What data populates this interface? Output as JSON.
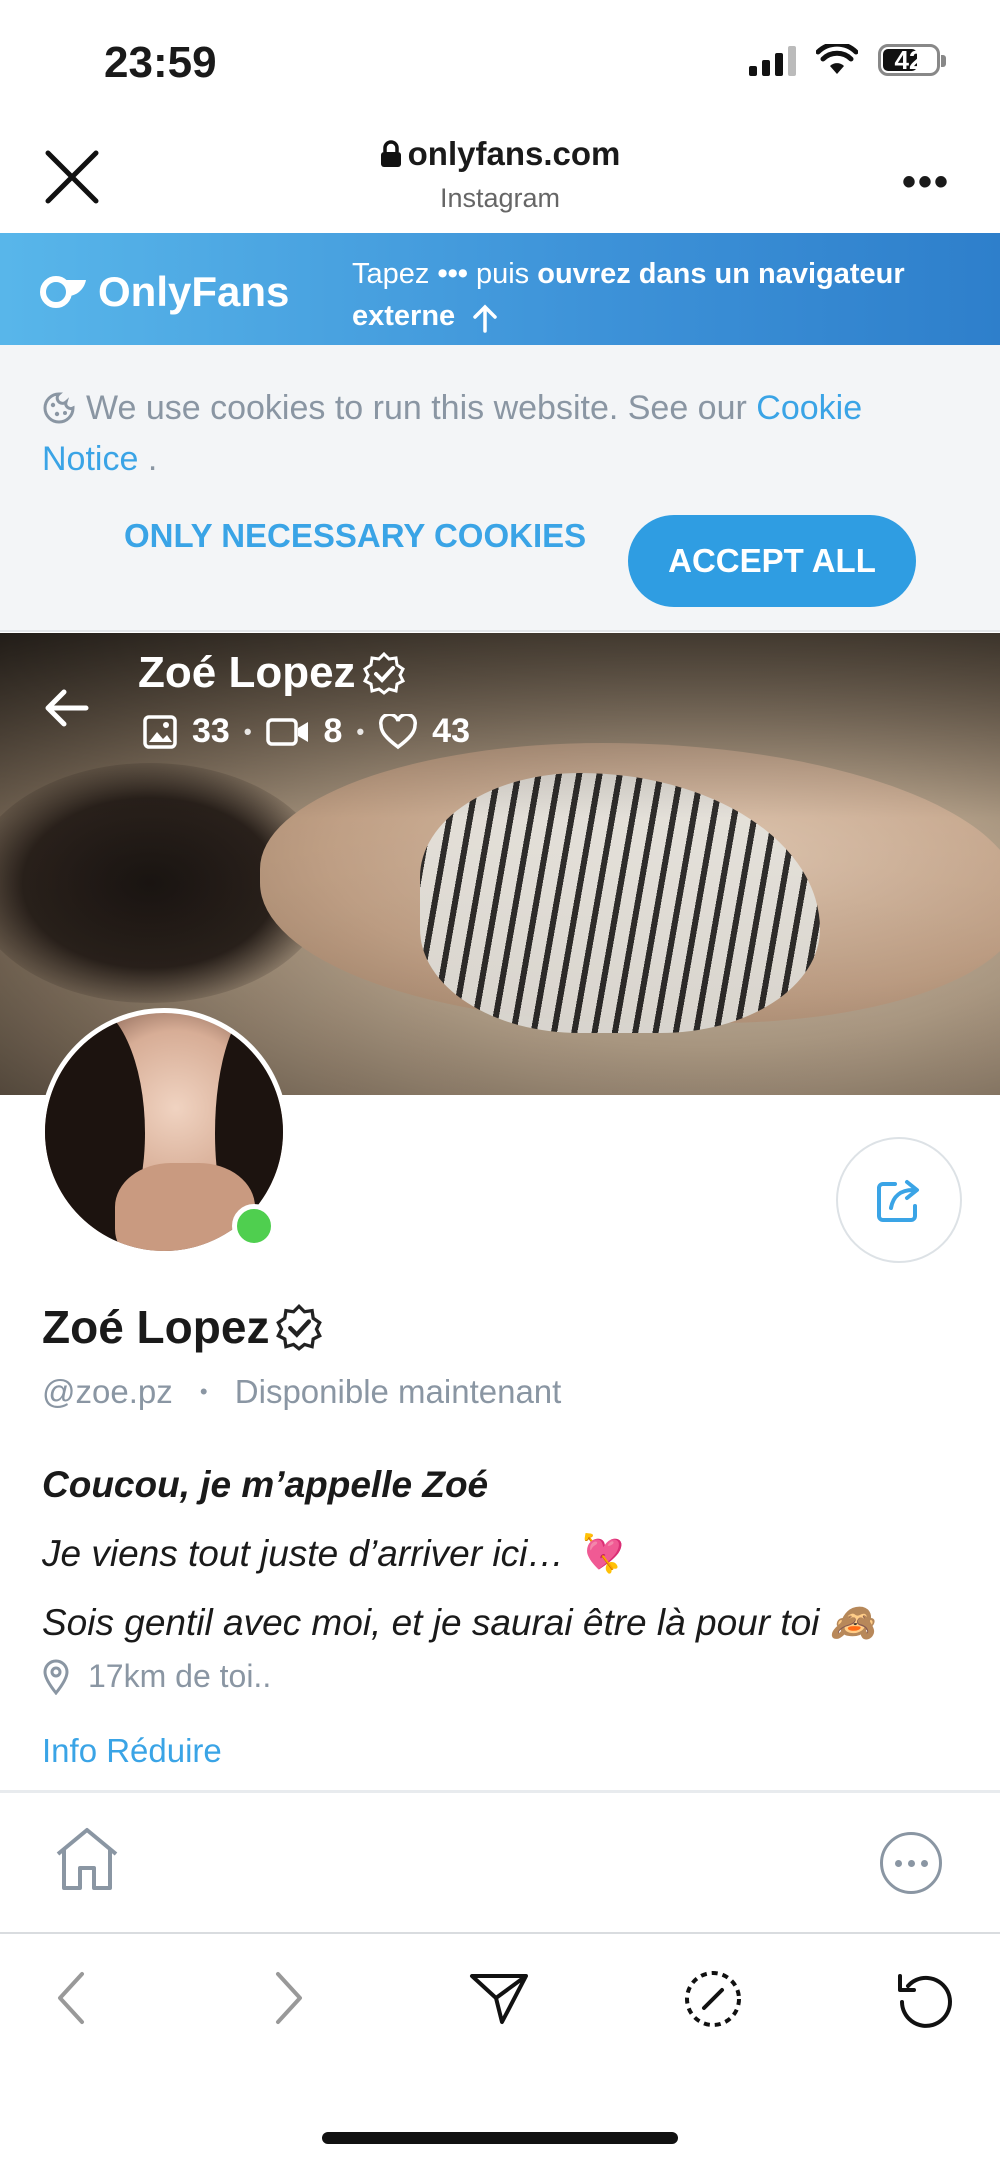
{
  "status_bar": {
    "time": "23:59",
    "battery": "42"
  },
  "browser": {
    "domain": "onlyfans.com",
    "subtitle": "Instagram",
    "more": "•••"
  },
  "banner": {
    "logo": "OnlyFans",
    "hint_part1": "Tapez",
    "hint_dots": "•••",
    "hint_part2": "puis",
    "hint_bold": "ouvrez dans un navigateur externe"
  },
  "cookies": {
    "text": "We use cookies to run this website. See our",
    "link": "Cookie Notice",
    "period": ".",
    "necessary_label": "ONLY NECESSARY COOKIES",
    "accept_label": "ACCEPT ALL"
  },
  "cover": {
    "name": "Zoé Lopez",
    "photos": "33",
    "videos": "8",
    "likes": "43"
  },
  "profile": {
    "name": "Zoé Lopez",
    "handle": "@zoe.pz",
    "separator": "•",
    "availability": "Disponible maintenant",
    "bio_line1": "Coucou, je m’appelle Zoé",
    "bio_line2": "Je viens tout juste d’arriver ici… 💘",
    "bio_line3": "Sois gentil avec moi, et je saurai être là pour toi 🙈",
    "location": "17km de toi..",
    "info_link": "Info Réduire"
  },
  "colors": {
    "accent": "#3aa4e6",
    "banner_start": "#58b6ea",
    "banner_end": "#2e7fcb",
    "online": "#4fcf4f"
  }
}
